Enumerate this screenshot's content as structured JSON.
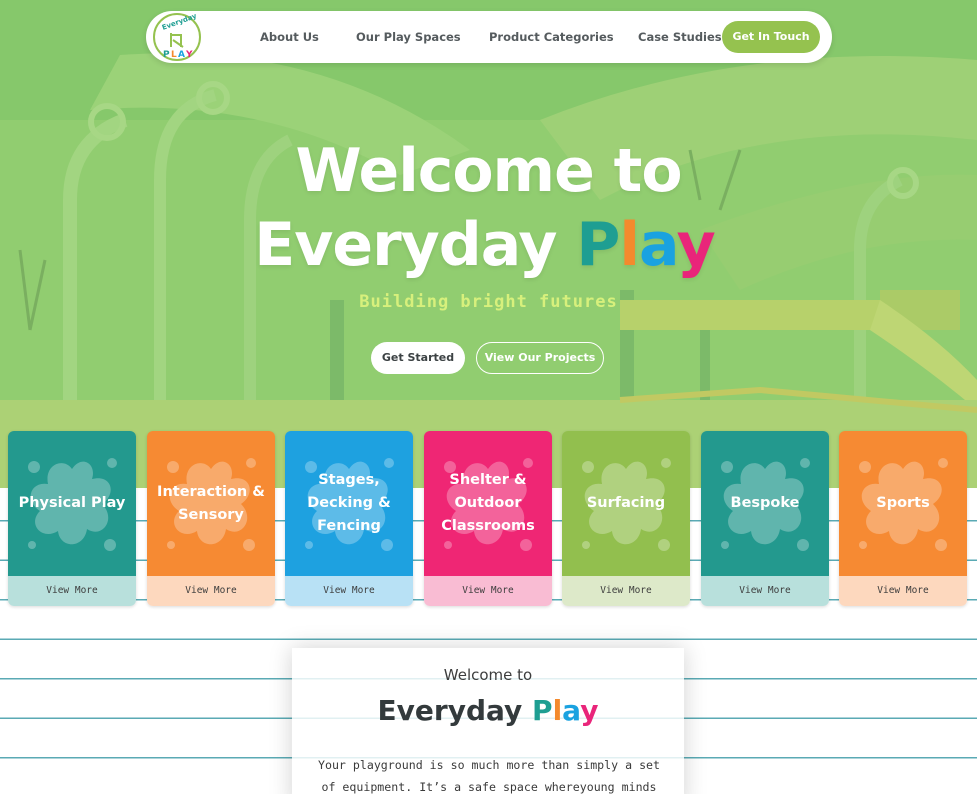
{
  "nav": {
    "logo_text": "Everyday PLAY",
    "links": [
      "About Us",
      "Our Play Spaces",
      "Product Categories",
      "Case Studies"
    ],
    "cta": "Get In Touch"
  },
  "hero": {
    "title_line1": "Welcome to",
    "title_line2_prefix": "Everyday",
    "title_play": [
      "P",
      "l",
      "a",
      "y"
    ],
    "subtitle": "Building bright futures",
    "primary_button": "Get Started",
    "secondary_button": "View Our Projects"
  },
  "categories": [
    {
      "title": "Physical Play",
      "link": "View More",
      "color": "#23998e",
      "light": "#b8e0dc"
    },
    {
      "title": "Interaction &\nSensory",
      "link": "View More",
      "color": "#f68a33",
      "light": "#fdd8be"
    },
    {
      "title": "Stages,\nDecking &\nFencing",
      "link": "View More",
      "color": "#1ea1e0",
      "light": "#b8e1f5"
    },
    {
      "title": "Shelter &\nOutdoor\nClassrooms",
      "link": "View More",
      "color": "#ef2674",
      "light": "#f9bcd3"
    },
    {
      "title": "Surfacing",
      "link": "View More",
      "color": "#92bf4e",
      "light": "#dde9c9"
    },
    {
      "title": "Bespoke",
      "link": "View More",
      "color": "#23998e",
      "light": "#b8e0dc"
    },
    {
      "title": "Sports",
      "link": "View More",
      "color": "#f68a33",
      "light": "#fdd8be"
    }
  ],
  "welcome": {
    "pre": "Welcome to",
    "title_prefix": "Everyday",
    "title_play": [
      "P",
      "l",
      "a",
      "y"
    ],
    "body": "Your playground is so much more than simply a set of equipment. It’s a safe space whereyoung minds"
  },
  "colors": {
    "accent_green": "#95c24f",
    "play_p": "#1e9e92",
    "play_l": "#f48a2d",
    "play_a": "#1aa2e0",
    "play_y": "#e9257a",
    "line_teal": "#5aaab4"
  }
}
